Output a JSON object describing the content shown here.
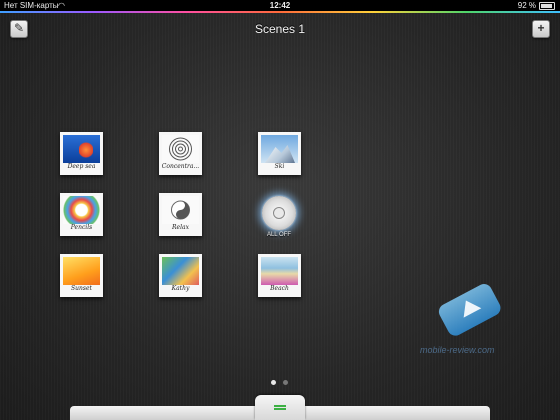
{
  "status_bar": {
    "carrier": "Нет SIM-карты",
    "time": "12:42",
    "battery_percent": "92 %",
    "battery_level": 0.92
  },
  "header": {
    "title": "Scenes 1",
    "edit_icon": "pencil-icon",
    "add_label": "+"
  },
  "scenes": [
    {
      "label": "Deep sea"
    },
    {
      "label": "Concentra..."
    },
    {
      "label": "Ski"
    },
    {
      "label": "Pencils"
    },
    {
      "label": "Relax"
    },
    {
      "label": "Sunset"
    },
    {
      "label": "Kathy"
    },
    {
      "label": "Beach"
    }
  ],
  "all_off": {
    "label": "ALL OFF"
  },
  "pagination": {
    "current_page": 1,
    "total_pages": 2
  },
  "watermark": {
    "text": "mobile-review.com"
  },
  "colors": {
    "accent_green": "#3cb043",
    "glow_blue": "#8cc8ff"
  }
}
